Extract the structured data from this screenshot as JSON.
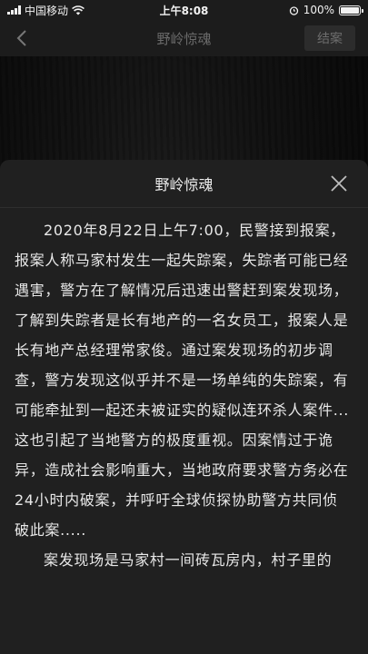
{
  "status_bar": {
    "carrier": "中国移动",
    "time": "上午8:08",
    "battery": "100%"
  },
  "nav": {
    "title": "野岭惊魂",
    "close_case_label": "结案"
  },
  "modal": {
    "title": "野岭惊魂",
    "paragraphs": [
      "2020年8月22日上午7:00，民警接到报案，报案人称马家村发生一起失踪案，失踪者可能已经遇害，警方在了解情况后迅速出警赶到案发现场，了解到失踪者是长有地产的一名女员工，报案人是长有地产总经理常家俊。通过案发现场的初步调查，警方发现这似乎并不是一场单纯的失踪案，有可能牵扯到一起还未被证实的疑似连环杀人案件...这也引起了当地警方的极度重视。因案情过于诡异，造成社会影响重大，当地政府要求警方务必在24小时内破案，并呼吁全球侦探协助警方共同侦破此案.....",
      "案发现场是马家村一间砖瓦房内，村子里的"
    ]
  },
  "icons": {
    "back": "chevron-left-icon",
    "close": "close-icon",
    "wifi": "wifi-icon",
    "alarm": "alarm-icon"
  }
}
